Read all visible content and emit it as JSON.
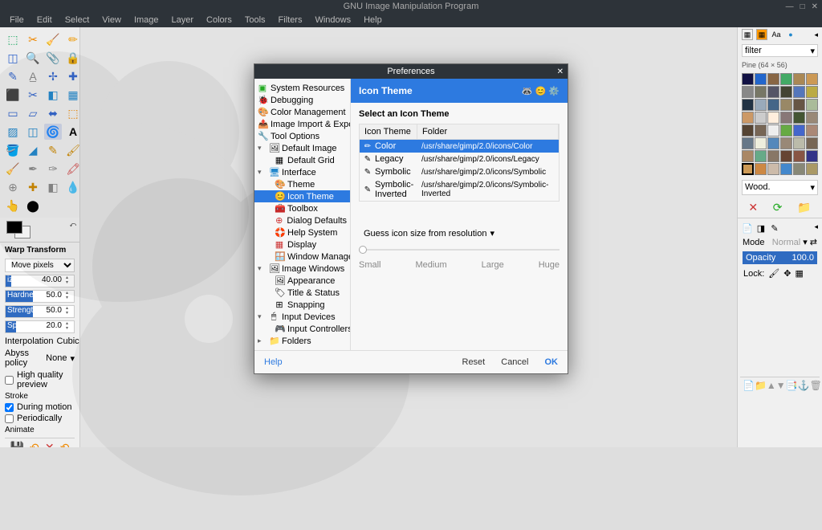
{
  "window": {
    "title": "GNU Image Manipulation Program"
  },
  "menu": {
    "items": [
      "File",
      "Edit",
      "Select",
      "View",
      "Image",
      "Layer",
      "Colors",
      "Tools",
      "Filters",
      "Windows",
      "Help"
    ]
  },
  "tool_options": {
    "title": "Warp Transform",
    "move_mode": "Move pixels",
    "size_label": "ize",
    "size_value": "40.00",
    "hardness_label": "Hardness",
    "hardness_value": "50.0",
    "strength_label": "Strength",
    "strength_value": "50.0",
    "spacing_label": "Spa",
    "spacing_value": "20.0",
    "interpolation_label": "Interpolation",
    "interpolation_value": "Cubic",
    "abyss_label": "Abyss policy",
    "abyss_value": "None",
    "hq_preview": "High quality preview",
    "stroke_section": "Stroke",
    "during_motion": "During motion",
    "periodically": "Periodically",
    "animate_section": "Animate"
  },
  "right": {
    "filter_label": "filter",
    "pattern_info": "Pine (64 × 56)",
    "wood_label": "Wood.",
    "mode_label": "Mode",
    "mode_value": "Normal",
    "opacity_label": "Opacity",
    "opacity_value": "100.0",
    "lock_label": "Lock:"
  },
  "dialog": {
    "title": "Preferences",
    "header_title": "Icon Theme",
    "tree": {
      "system_resources": "System Resources",
      "debugging": "Debugging",
      "color_management": "Color Management",
      "image_import_export": "Image Import & Export",
      "tool_options": "Tool Options",
      "default_image": "Default Image",
      "default_grid": "Default Grid",
      "interface": "Interface",
      "theme": "Theme",
      "icon_theme": "Icon Theme",
      "toolbox": "Toolbox",
      "dialog_defaults": "Dialog Defaults",
      "help_system": "Help System",
      "display": "Display",
      "window_management": "Window Management",
      "image_windows": "Image Windows",
      "appearance": "Appearance",
      "title_status": "Title & Status",
      "snapping": "Snapping",
      "input_devices": "Input Devices",
      "input_controllers": "Input Controllers",
      "folders": "Folders"
    },
    "content": {
      "select_label": "Select an Icon Theme",
      "col_name": "Icon Theme",
      "col_folder": "Folder",
      "rows": [
        {
          "name": "Color",
          "folder": "/usr/share/gimp/2.0/icons/Color"
        },
        {
          "name": "Legacy",
          "folder": "/usr/share/gimp/2.0/icons/Legacy"
        },
        {
          "name": "Symbolic",
          "folder": "/usr/share/gimp/2.0/icons/Symbolic"
        },
        {
          "name": "Symbolic-Inverted",
          "folder": "/usr/share/gimp/2.0/icons/Symbolic-Inverted"
        }
      ],
      "guess_label": "Guess icon size from resolution",
      "size_small": "Small",
      "size_medium": "Medium",
      "size_large": "Large",
      "size_huge": "Huge"
    },
    "footer": {
      "help": "Help",
      "reset": "Reset",
      "cancel": "Cancel",
      "ok": "OK"
    }
  }
}
